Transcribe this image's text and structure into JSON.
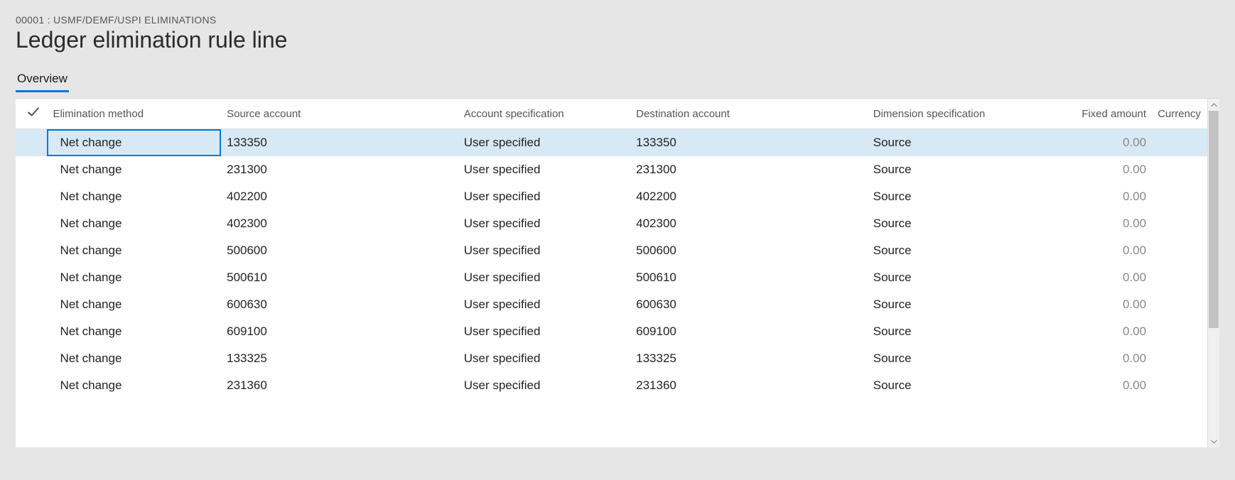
{
  "header": {
    "breadcrumb": "00001 : USMF/DEMF/USPI ELIMINATIONS",
    "title": "Ledger elimination rule line"
  },
  "tabs": {
    "overview": "Overview"
  },
  "grid": {
    "columns": {
      "elimination_method": "Elimination method",
      "source_account": "Source account",
      "account_specification": "Account specification",
      "destination_account": "Destination account",
      "dimension_specification": "Dimension specification",
      "fixed_amount": "Fixed amount",
      "currency": "Currency"
    },
    "rows": [
      {
        "elimination_method": "Net change",
        "source_account": "133350",
        "account_specification": "User specified",
        "destination_account": "133350",
        "dimension_specification": "Source",
        "fixed_amount": "0.00",
        "currency": "",
        "selected": true
      },
      {
        "elimination_method": "Net change",
        "source_account": "231300",
        "account_specification": "User specified",
        "destination_account": "231300",
        "dimension_specification": "Source",
        "fixed_amount": "0.00",
        "currency": ""
      },
      {
        "elimination_method": "Net change",
        "source_account": "402200",
        "account_specification": "User specified",
        "destination_account": "402200",
        "dimension_specification": "Source",
        "fixed_amount": "0.00",
        "currency": ""
      },
      {
        "elimination_method": "Net change",
        "source_account": "402300",
        "account_specification": "User specified",
        "destination_account": "402300",
        "dimension_specification": "Source",
        "fixed_amount": "0.00",
        "currency": ""
      },
      {
        "elimination_method": "Net change",
        "source_account": "500600",
        "account_specification": "User specified",
        "destination_account": "500600",
        "dimension_specification": "Source",
        "fixed_amount": "0.00",
        "currency": ""
      },
      {
        "elimination_method": "Net change",
        "source_account": "500610",
        "account_specification": "User specified",
        "destination_account": "500610",
        "dimension_specification": "Source",
        "fixed_amount": "0.00",
        "currency": ""
      },
      {
        "elimination_method": "Net change",
        "source_account": "600630",
        "account_specification": "User specified",
        "destination_account": "600630",
        "dimension_specification": "Source",
        "fixed_amount": "0.00",
        "currency": ""
      },
      {
        "elimination_method": "Net change",
        "source_account": "609100",
        "account_specification": "User specified",
        "destination_account": "609100",
        "dimension_specification": "Source",
        "fixed_amount": "0.00",
        "currency": ""
      },
      {
        "elimination_method": "Net change",
        "source_account": "133325",
        "account_specification": "User specified",
        "destination_account": "133325",
        "dimension_specification": "Source",
        "fixed_amount": "0.00",
        "currency": ""
      },
      {
        "elimination_method": "Net change",
        "source_account": "231360",
        "account_specification": "User specified",
        "destination_account": "231360",
        "dimension_specification": "Source",
        "fixed_amount": "0.00",
        "currency": ""
      }
    ]
  }
}
